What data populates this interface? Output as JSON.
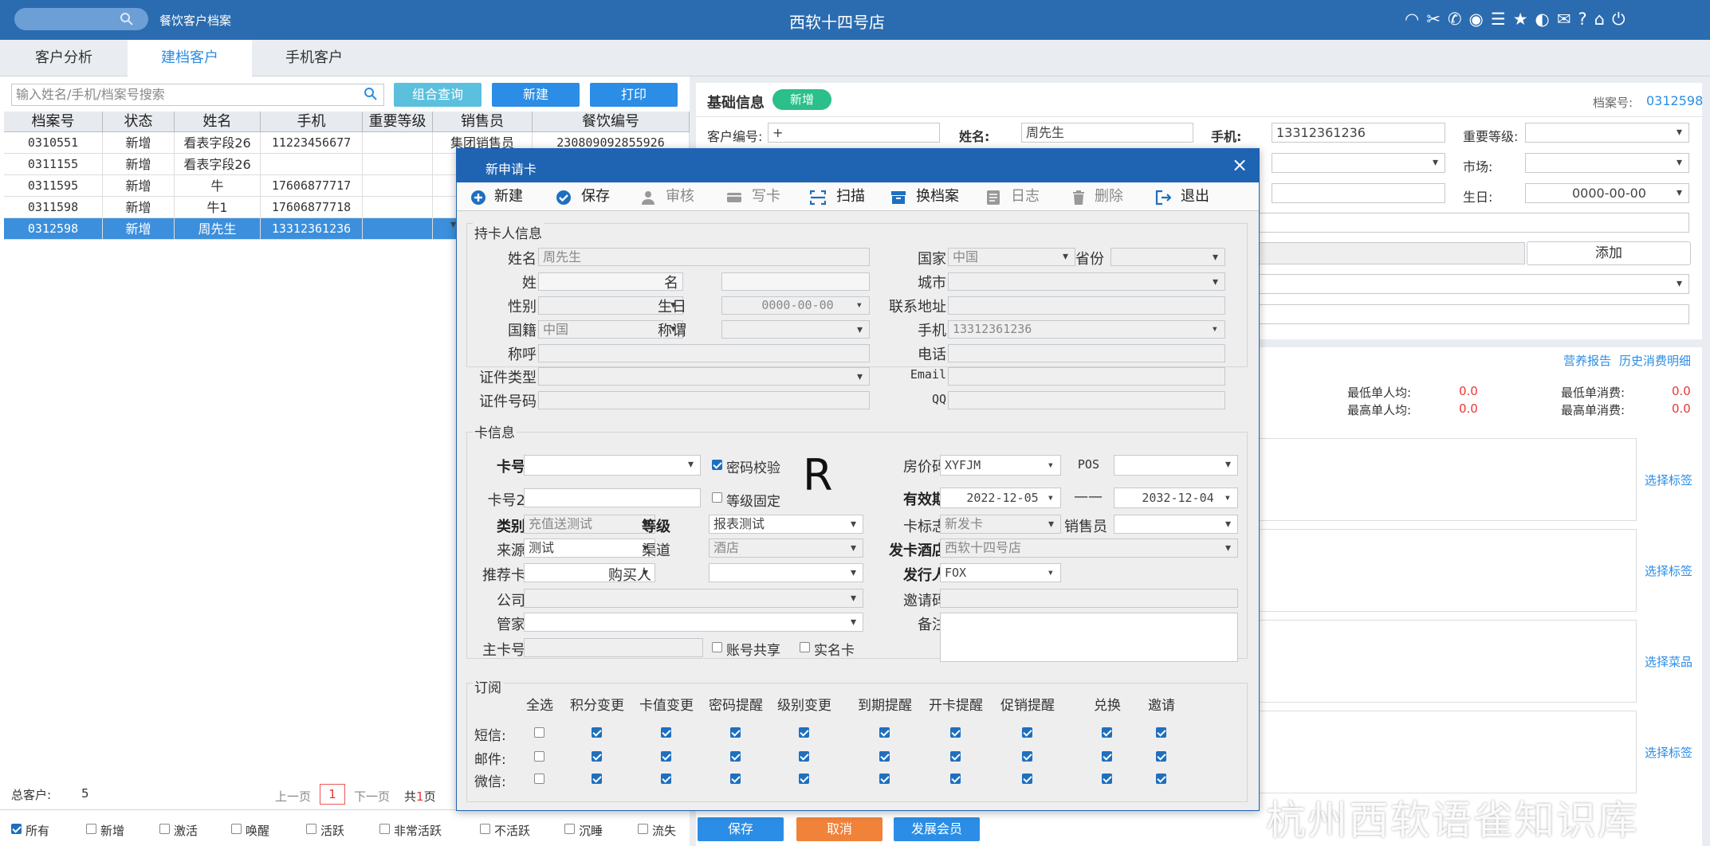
{
  "topbar": {
    "search_placeholder": "",
    "module": "餐饮客户档案",
    "store": "西软十四号店"
  },
  "tabs": [
    "客户分析",
    "建档客户",
    "手机客户"
  ],
  "left": {
    "search_placeholder": "输入姓名/手机/档案号搜索",
    "buttons": {
      "combo": "组合查询",
      "new": "新建",
      "print": "打印"
    },
    "columns": [
      "档案号",
      "状态",
      "姓名",
      "手机",
      "重要等级",
      "销售员",
      "餐饮编号"
    ],
    "rows": [
      [
        "0310551",
        "新增",
        "看表字段26",
        "11223456677",
        "",
        "集团销售员",
        "230809092855926"
      ],
      [
        "0311155",
        "新增",
        "看表字段26",
        "",
        "",
        "",
        ""
      ],
      [
        "0311595",
        "新增",
        "牛",
        "17606877717",
        "",
        "",
        ""
      ],
      [
        "0311598",
        "新增",
        "牛1",
        "17606877718",
        "",
        "",
        ""
      ],
      [
        "0312598",
        "新增",
        "周先生",
        "13312361236",
        "",
        "",
        ""
      ]
    ],
    "total_label": "总客户:",
    "total": "5",
    "prev": "上一页",
    "page": "1",
    "next": "下一页",
    "pages_prefix": "共",
    "pages": "1",
    "pages_suffix": "页",
    "filters": [
      "所有",
      "新增",
      "激活",
      "唤醒",
      "活跃",
      "非常活跃",
      "不活跃",
      "沉睡",
      "流失"
    ]
  },
  "right": {
    "title": "基础信息",
    "badge": "新增",
    "file_no_label": "档案号:",
    "file_no": "0312598",
    "fields": {
      "cust_no_label": "客户编号:",
      "cust_no": "+",
      "name_label": "姓名:",
      "name": "周先生",
      "mobile_label": "手机:",
      "mobile": "13312361236",
      "level_label": "重要等级:",
      "market_label": "市场:",
      "birthday_label": "生日:",
      "birthday": "0000-00-00"
    },
    "add_button": "添加",
    "links": {
      "report": "营养报告",
      "history": "历史消费明细"
    },
    "stats": {
      "min_avg_label": "最低单人均:",
      "min_avg": "0.0",
      "max_avg_label": "最高单人均:",
      "max_avg": "0.0",
      "min_cons_label": "最低单消费:",
      "min_cons": "0.0",
      "max_cons_label": "最高单消费:",
      "max_cons": "0.0"
    },
    "tag_links": [
      "选择标签",
      "选择标签",
      "选择菜品",
      "选择标签"
    ],
    "bottom_buttons": {
      "save": "保存",
      "cancel": "取消",
      "member": "发展会员"
    }
  },
  "dialog": {
    "title": "新申请卡",
    "close": "×",
    "toolbar": [
      "新建",
      "保存",
      "审核",
      "写卡",
      "扫描",
      "换档案",
      "日志",
      "删除",
      "退出"
    ],
    "holder": {
      "section": "持卡人信息",
      "name_label": "姓名",
      "name": "周先生",
      "surname_label": "姓",
      "given_label": "名",
      "gender_label": "性别",
      "birthday_label": "生日",
      "birthday": "0000-00-00",
      "nationality_label": "国籍",
      "nationality": "中国",
      "title_label": "称谓",
      "salutation_label": "称呼",
      "id_type_label": "证件类型",
      "id_no_label": "证件号码",
      "country_label": "国家",
      "country": "中国",
      "province_label": "省份",
      "city_label": "城市",
      "address_label": "联系地址",
      "mobile_label": "手机",
      "mobile": "13312361236",
      "phone_label": "电话",
      "email_label": "Email",
      "qq_label": "QQ"
    },
    "card": {
      "section": "卡信息",
      "card_no_label": "卡号",
      "pwd_check": "密码校验",
      "big_letter": "R",
      "card_no2_label": "卡号2",
      "level_fixed": "等级固定",
      "type_label": "类别",
      "type": "充值送测试",
      "grade_label": "等级",
      "grade": "报表测试",
      "source_label": "来源",
      "source": "测试",
      "channel_label": "渠道",
      "channel": "酒店",
      "referrer_label": "推荐卡",
      "buyer_label": "购买人",
      "company_label": "公司",
      "butler_label": "管家",
      "master_label": "主卡号",
      "share": "账号共享",
      "realname": "实名卡",
      "rate_label": "房价码",
      "rate": "XYFJM",
      "pos_label": "POS",
      "valid_label": "有效期",
      "valid_from": "2022-12-05",
      "valid_sep": "——",
      "valid_to": "2032-12-04",
      "flag_label": "卡标志",
      "flag": "新发卡",
      "seller_label": "销售员",
      "hotel_label": "发卡酒店",
      "hotel": "西软十四号店",
      "issuer_label": "发行人",
      "issuer": "FOX",
      "invite_label": "邀请码",
      "remark_label": "备注"
    },
    "subscribe": {
      "section": "订阅",
      "columns": [
        "全选",
        "积分变更",
        "卡值变更",
        "密码提醒",
        "级别变更",
        "到期提醒",
        "开卡提醒",
        "促销提醒",
        "兑换",
        "邀请"
      ],
      "rows": [
        "短信:",
        "邮件:",
        "微信:"
      ]
    }
  },
  "watermark": "杭州西软语雀知识库",
  "colors": {
    "topbar": "#2b6cb0",
    "dialog_header": "#1f63b3",
    "selected_row": "#3c8fdc",
    "cyan_button": "#5bc0de",
    "blue_button": "#2b8de5",
    "orange_button": "#f0823a",
    "green_badge": "#2bbf8a"
  }
}
